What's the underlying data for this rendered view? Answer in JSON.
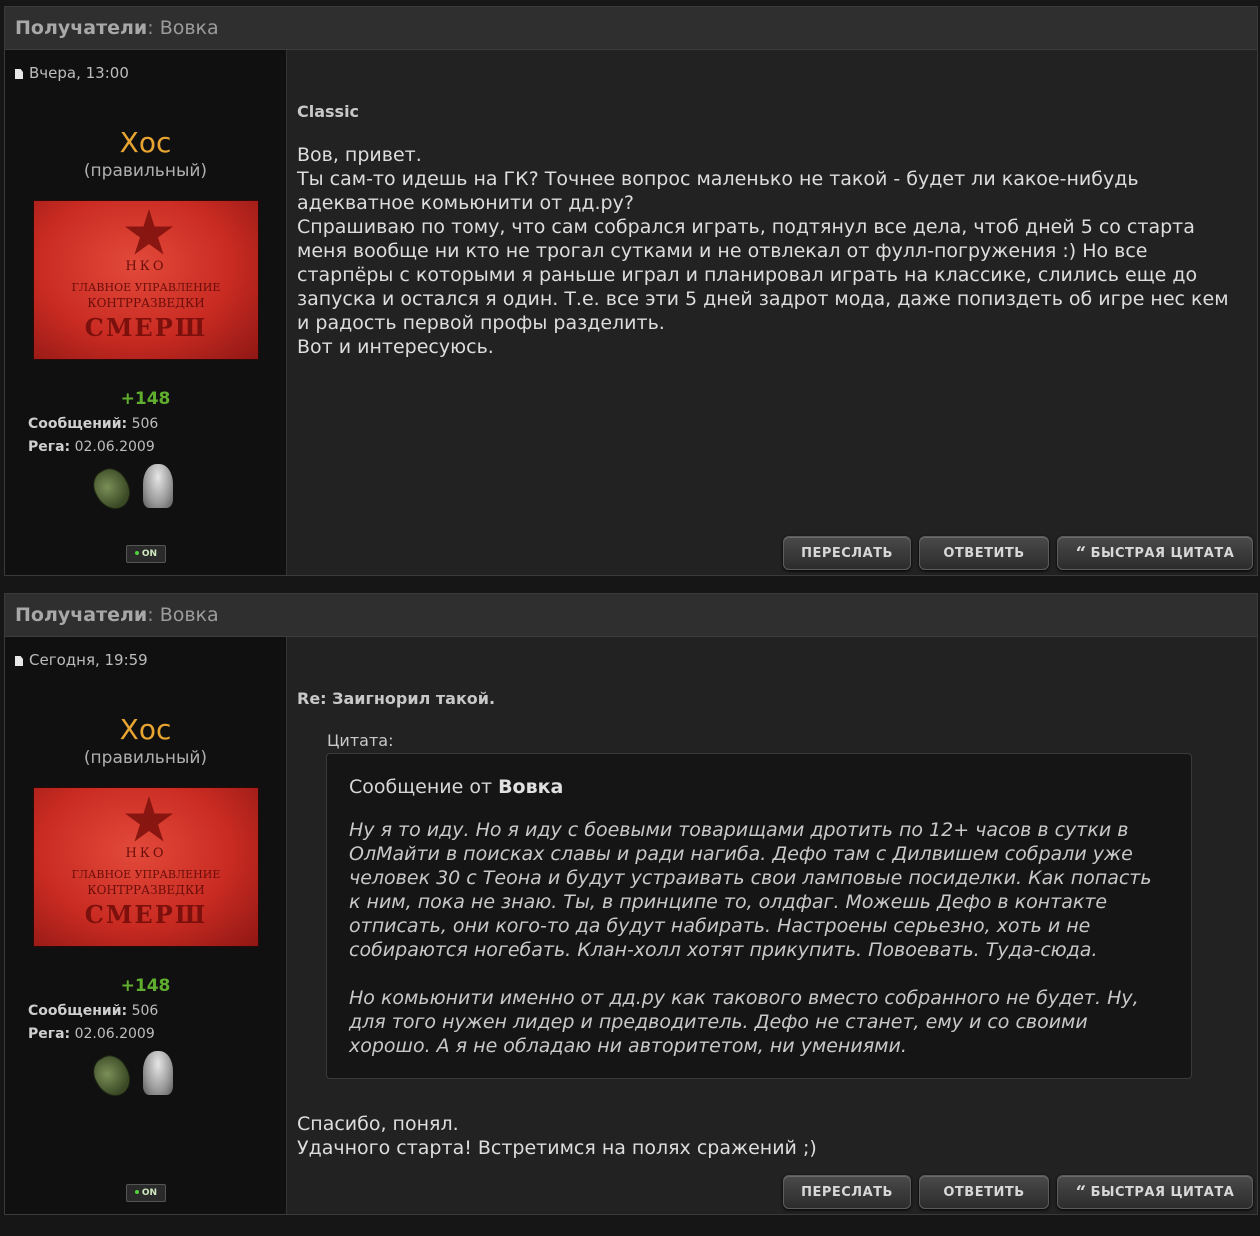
{
  "posts": [
    {
      "header": {
        "recipients_label": "Получатели",
        "separator": ":",
        "recipient": "Вовка"
      },
      "date": "Вчера, 13:00",
      "user": {
        "name": "Хос",
        "title": "(правильный)",
        "avatar_text": [
          "НКО",
          "ГЛАВНОЕ УПРАВЛЕНИЕ",
          "КОНТРРАЗВЕДКИ",
          "СМЕРШ"
        ],
        "reputation": "+148",
        "messages_label": "Сообщений:",
        "messages_value": "506",
        "reg_label": "Рега:",
        "reg_value": "02.06.2009",
        "online": "ON"
      },
      "title": "Classic",
      "text": "Вов, привет.\nТы сам-то идешь на ГК? Точнее вопрос маленько не такой - будет ли какое-нибудь адекватное комьюнити от дд.ру?\nСпрашиваю по тому, что сам собрался играть, подтянул все дела, чтоб дней 5 со старта меня вообще ни кто не трогал сутками и не отвлекал от фулл-погружения :) Но все старпёры с которыми я раньше играл и планировал играть на классике, слились еще до запуска и остался я один. Т.е. все эти 5 дней задрот мода, даже попиздеть об игре нес кем и радость первой профы разделить.\nВот и интересуюсь.",
      "buttons": {
        "forward": "ПЕРЕСЛАТЬ",
        "reply": "ОТВЕТИТЬ",
        "quick_quote": "БЫСТРАЯ ЦИТАТА"
      }
    },
    {
      "header": {
        "recipients_label": "Получатели",
        "separator": ":",
        "recipient": "Вовка"
      },
      "date": "Сегодня, 19:59",
      "user": {
        "name": "Хос",
        "title": "(правильный)",
        "avatar_text": [
          "НКО",
          "ГЛАВНОЕ УПРАВЛЕНИЕ",
          "КОНТРРАЗВЕДКИ",
          "СМЕРШ"
        ],
        "reputation": "+148",
        "messages_label": "Сообщений:",
        "messages_value": "506",
        "reg_label": "Рега:",
        "reg_value": "02.06.2009",
        "online": "ON"
      },
      "title": "Re: Заигнорил такой.",
      "quote": {
        "label": "Цитата:",
        "head_prefix": "Сообщение от",
        "author": "Вовка",
        "paragraph1": "Ну я то иду. Но я иду с боевыми товарищами дротить по 12+ часов в сутки в ОлМайти в поисках славы и ради нагиба. Дефо там с Дилвишем собрали уже человек 30 с Теона и будут устраивать свои ламповые посиделки. Как попасть к ним, пока не знаю. Ты, в принципе то, олдфаг. Можешь Дефо в контакте отписать, они кого-то да будут набирать. Настроены серьезно, хоть и не собираются ногебать. Клан-холл хотят прикупить. Повоевать. Туда-сюда.",
        "paragraph2": "Но комьюнити именно от дд.ру как такового вместо собранного не будет. Ну, для того нужен лидер и предводитель. Дефо не станет, ему и со своими хорошо. А я не обладаю ни авторитетом, ни умениями."
      },
      "text": "Спасибо, понял.\nУдачного старта! Встретимся на полях сражений ;)",
      "buttons": {
        "forward": "ПЕРЕСЛАТЬ",
        "reply": "ОТВЕТИТЬ",
        "quick_quote": "БЫСТРАЯ ЦИТАТА"
      }
    }
  ]
}
